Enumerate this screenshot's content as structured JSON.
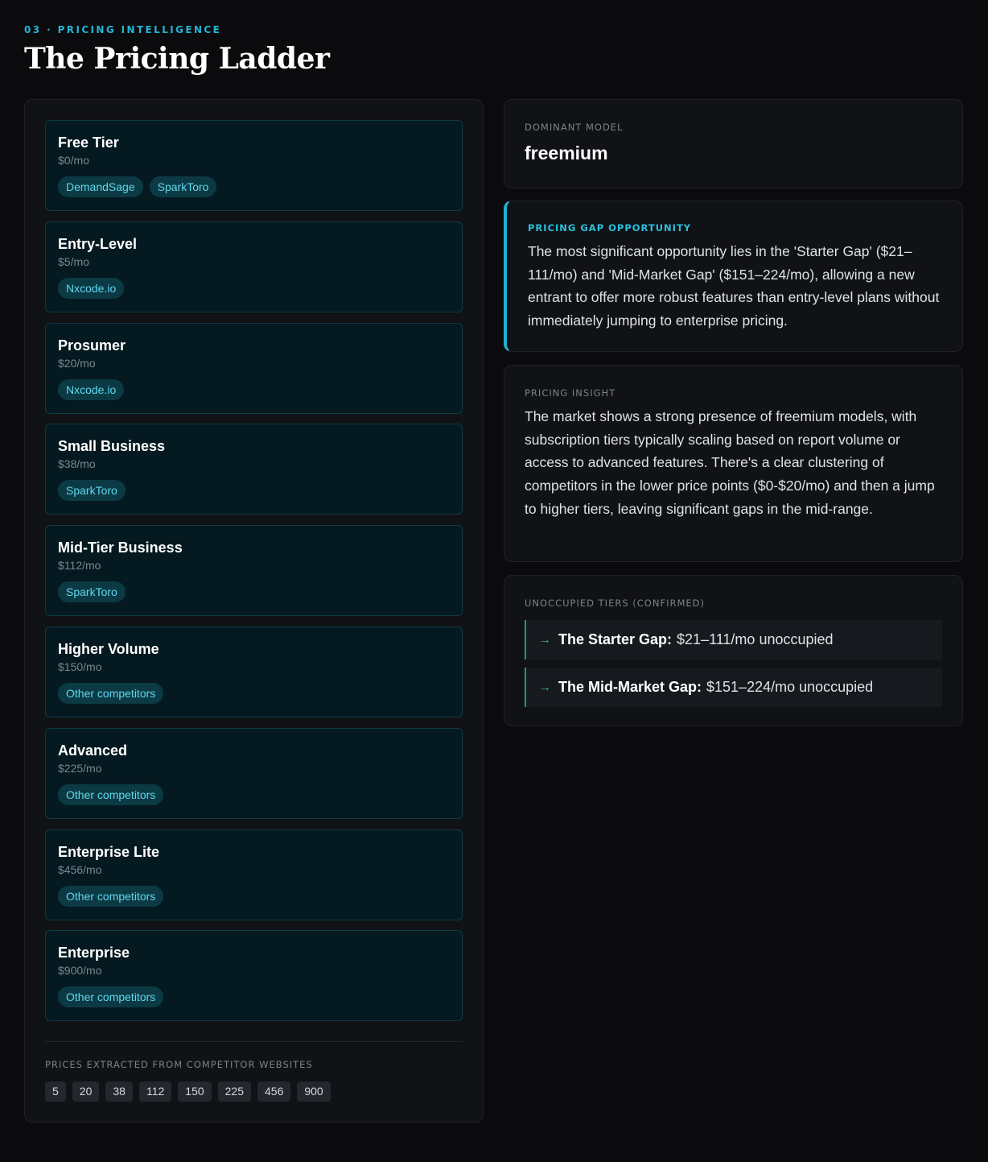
{
  "header": {
    "eyebrow": "03 · PRICING INTELLIGENCE",
    "title": "The Pricing Ladder"
  },
  "tiers": [
    {
      "name": "Free Tier",
      "price": "$0/mo",
      "competitors": [
        "DemandSage",
        "SparkToro"
      ]
    },
    {
      "name": "Entry-Level",
      "price": "$5/mo",
      "competitors": [
        "Nxcode.io"
      ]
    },
    {
      "name": "Prosumer",
      "price": "$20/mo",
      "competitors": [
        "Nxcode.io"
      ]
    },
    {
      "name": "Small Business",
      "price": "$38/mo",
      "competitors": [
        "SparkToro"
      ]
    },
    {
      "name": "Mid-Tier Business",
      "price": "$112/mo",
      "competitors": [
        "SparkToro"
      ]
    },
    {
      "name": "Higher Volume",
      "price": "$150/mo",
      "competitors": [
        "Other competitors"
      ]
    },
    {
      "name": "Advanced",
      "price": "$225/mo",
      "competitors": [
        "Other competitors"
      ]
    },
    {
      "name": "Enterprise Lite",
      "price": "$456/mo",
      "competitors": [
        "Other competitors"
      ]
    },
    {
      "name": "Enterprise",
      "price": "$900/mo",
      "competitors": [
        "Other competitors"
      ]
    }
  ],
  "prices_footer": {
    "label": "PRICES EXTRACTED FROM COMPETITOR WEBSITES",
    "values": [
      "5",
      "20",
      "38",
      "112",
      "150",
      "225",
      "456",
      "900"
    ]
  },
  "dominant_model": {
    "label": "DOMINANT MODEL",
    "value": "freemium"
  },
  "gap_opportunity": {
    "label": "PRICING GAP OPPORTUNITY",
    "text": "The most significant opportunity lies in the 'Starter Gap' ($21–111/mo) and 'Mid-Market Gap' ($151–224/mo), allowing a new entrant to offer more robust features than entry-level plans without immediately jumping to enterprise pricing."
  },
  "insight": {
    "label": "PRICING INSIGHT",
    "text": "The market shows a strong presence of freemium models, with subscription tiers typically scaling based on report volume or access to advanced features. There's a clear clustering of competitors in the lower price points ($0-$20/mo) and then a jump to higher tiers, leaving significant gaps in the mid-range."
  },
  "unoccupied": {
    "label": "UNOCCUPIED TIERS (CONFIRMED)",
    "gaps": [
      {
        "arrow": "→",
        "name": "The Starter Gap:",
        "detail": "$21–111/mo unoccupied"
      },
      {
        "arrow": "→",
        "name": "The Mid-Market Gap:",
        "detail": "$151–224/mo unoccupied"
      }
    ]
  },
  "colors": {
    "accent": "#22b5d6",
    "chip_text": "#5fd8ee",
    "gap_border": "#1f9e6a",
    "arrow": "#22c27c"
  }
}
